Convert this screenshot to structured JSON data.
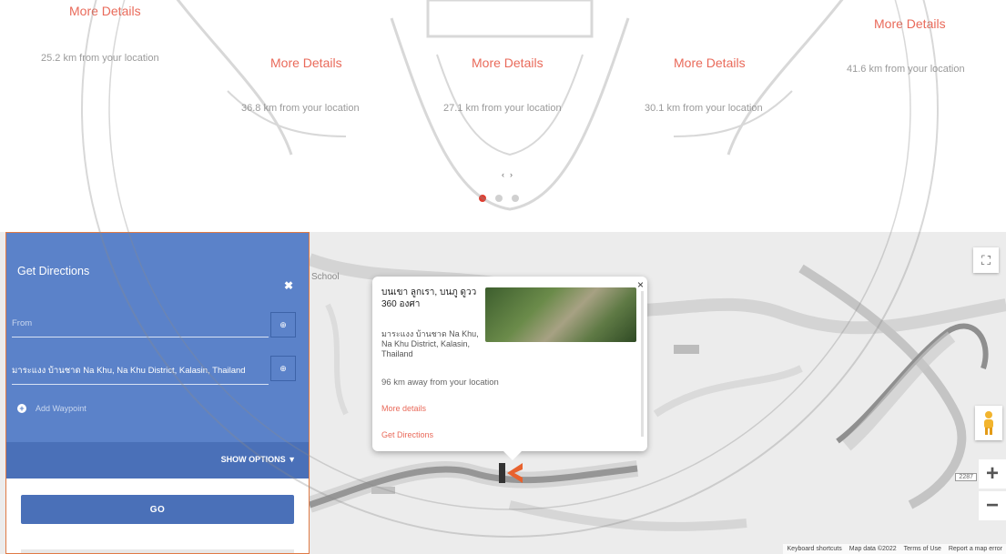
{
  "places": [
    {
      "more": "More Details",
      "distance": "25.2 km from your location"
    },
    {
      "more": "More Details",
      "distance": "36.8 km from your location"
    },
    {
      "more": "More Details",
      "distance": "27.1 km from your location"
    },
    {
      "more": "More Details",
      "distance": "30.1 km from your location"
    },
    {
      "more": "More Details",
      "distance": "41.6 km from your location"
    }
  ],
  "carousel": {
    "prev": "‹",
    "next": "›",
    "active_slide": 1,
    "slide_count": 3
  },
  "directions": {
    "title": "Get Directions",
    "close_icon": "✖",
    "from_placeholder": "From",
    "to_value": "มาระแงง บ้านชาด Na Khu, Na Khu District, Kalasin, Thailand",
    "add_destination": "Add Waypoint",
    "locate_icon": "⊕",
    "show_options": "SHOW OPTIONS ▼",
    "go": "GO"
  },
  "map": {
    "label_school": "School",
    "road_number": "2287",
    "fullscreen_icon": "⛶",
    "zoom_in": "+",
    "zoom_out": "−",
    "attribution": [
      "Keyboard shortcuts",
      "Map data ©2022",
      "Terms of Use",
      "Report a map error"
    ]
  },
  "info_window": {
    "title": "บนเขา ลูกเรา, บนภู ดูวว 360 องศา",
    "address": "มาระแงง บ้านชาด Na Khu, Na Khu District, Kalasin, Thailand",
    "distance": "96 km away from your location",
    "more_details": "More details",
    "get_directions": "Get Directions",
    "close": "×"
  },
  "colors": {
    "accent": "#e96a5a",
    "panel": "#5b82c9",
    "panel_dark": "#4a70b8",
    "active_dot": "#e23b2e"
  }
}
